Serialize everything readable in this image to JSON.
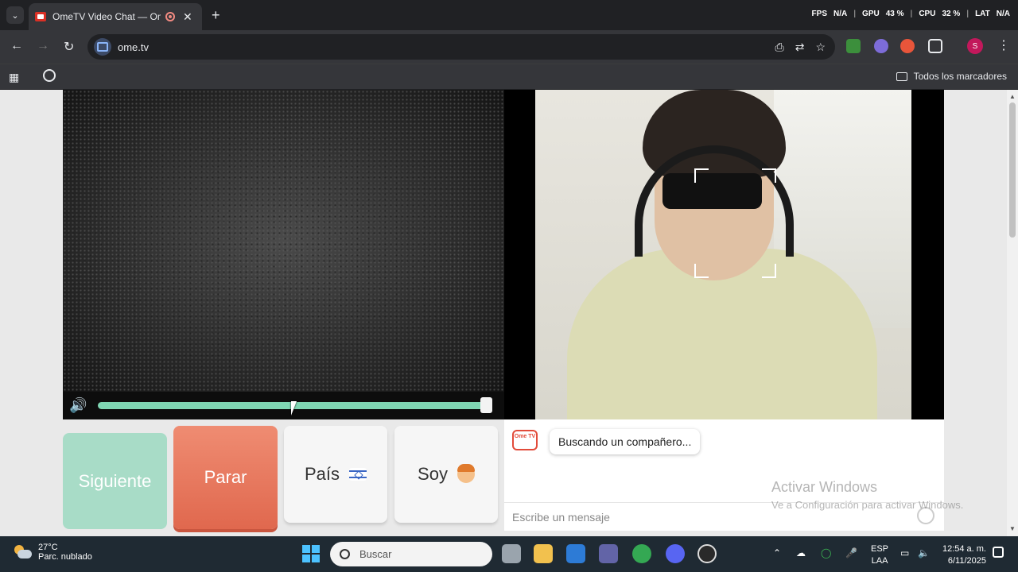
{
  "browser": {
    "tab_title": "OmeTV Video Chat — Ome",
    "url": "ome.tv",
    "bookmarks_all": "Todos los marcadores",
    "stats": [
      "FPS",
      "N/A",
      "GPU",
      "43 %",
      "CPU",
      "32 %",
      "LAT",
      "N/A"
    ]
  },
  "video": {
    "volume_level": 1.0
  },
  "controls": {
    "next_label": "Siguiente",
    "stop_label": "Parar",
    "country_label": "País",
    "gender_label": "Soy"
  },
  "chat": {
    "logo_text": "Ome TV",
    "status_message": "Buscando un compañero...",
    "input_placeholder": "Escribe un mensaje"
  },
  "watermark": {
    "line1": "Activar Windows",
    "line2": "Ve a Configuración para activar Windows."
  },
  "taskbar": {
    "temperature": "27°C",
    "weather": "Parc. nublado",
    "search_placeholder": "Buscar",
    "lang_top": "ESP",
    "lang_bottom": "LAA",
    "time": "12:54 a. m.",
    "date": "6/11/2025"
  }
}
